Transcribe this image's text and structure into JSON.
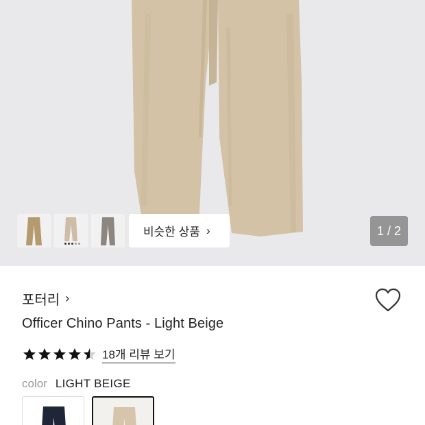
{
  "gallery": {
    "pager": "1 / 2",
    "similar_label": "비슷한 상품",
    "similar_chevron": "›",
    "thumbnails": [
      {
        "name": "khaki-thumbnail",
        "color": "#b59a6f"
      },
      {
        "name": "light-beige-thumbnail",
        "color": "#cdbda6"
      },
      {
        "name": "gray-thumbnail",
        "color": "#8d8580"
      }
    ]
  },
  "product": {
    "brand": "포터리",
    "brand_chevron": "›",
    "title": "Officer Chino Pants - Light Beige",
    "rating": 4.5,
    "review_link": "18개 리뷰 보기",
    "color_label": "color",
    "color_value": "LIGHT BEIGE",
    "swatches": [
      {
        "name": "navy",
        "color": "#1f2638",
        "selected": false
      },
      {
        "name": "light-beige",
        "color": "#d6c5aa",
        "selected": true
      }
    ]
  },
  "colors": {
    "pants_main": "#d3c2a5",
    "pants_shade": "#c8b697",
    "hero_bg": "#e9e9eb",
    "star": "#111111"
  },
  "icons": {
    "heart": "heart-outline-icon",
    "star": "star-icon",
    "chevron": "chevron-right-icon"
  }
}
